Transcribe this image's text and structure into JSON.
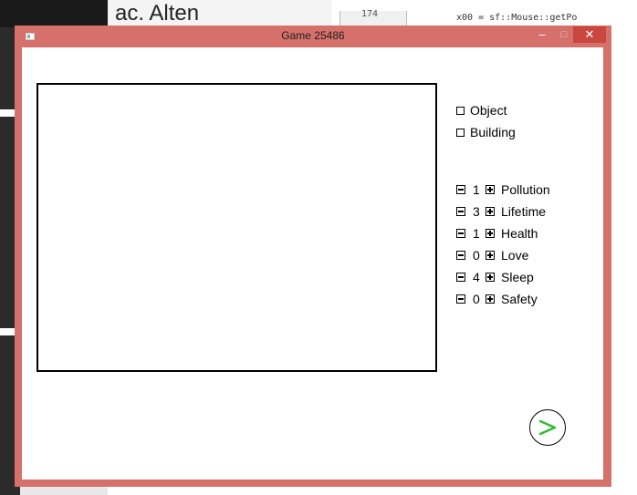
{
  "background": {
    "other_window_title": "ac. Alten",
    "scroll_number": "174",
    "code_line": "x00 = sf::Mouse::getPo"
  },
  "window": {
    "title": "Game 25486",
    "controls": {
      "minimize": "–",
      "maximize": "□",
      "close": "✕"
    }
  },
  "sidebar": {
    "checkboxes": [
      {
        "label": "Object",
        "checked": false
      },
      {
        "label": "Building",
        "checked": false
      }
    ],
    "stats": [
      {
        "value": "1",
        "name": "Pollution"
      },
      {
        "value": "3",
        "name": "Lifetime"
      },
      {
        "value": "1",
        "name": "Health"
      },
      {
        "value": "0",
        "name": "Love"
      },
      {
        "value": "4",
        "name": "Sleep"
      },
      {
        "value": "0",
        "name": "Safety"
      }
    ]
  },
  "next_button": {
    "label": ">",
    "color": "#2dbb2d"
  },
  "colors": {
    "window_border": "#d5706a",
    "close_button": "#c9473f"
  }
}
